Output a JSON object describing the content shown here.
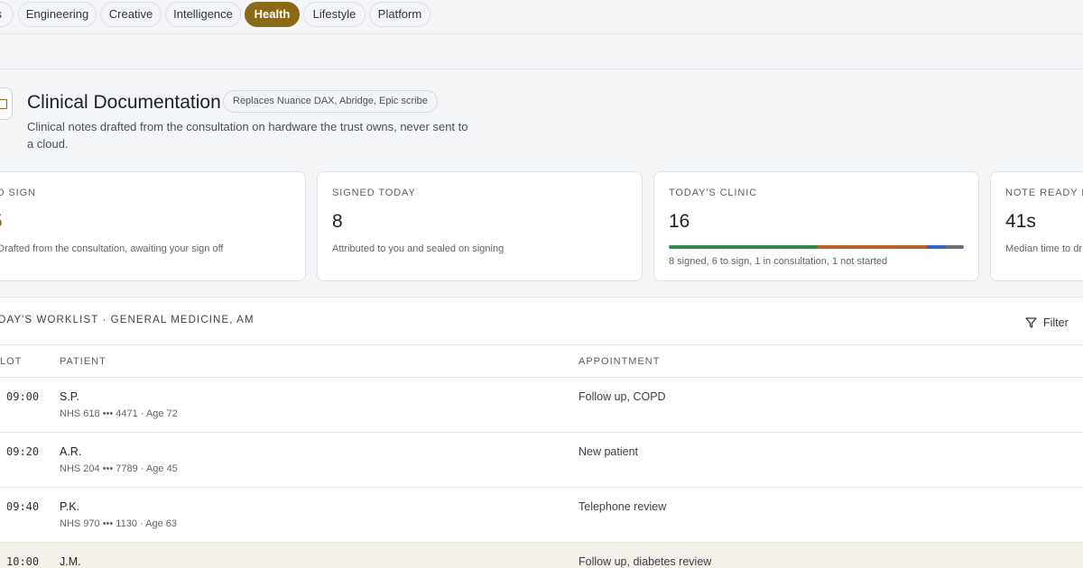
{
  "tabs": [
    {
      "label": "s",
      "active": false
    },
    {
      "label": "Engineering",
      "active": false
    },
    {
      "label": "Creative",
      "active": false
    },
    {
      "label": "Intelligence",
      "active": false
    },
    {
      "label": "Health",
      "active": true
    },
    {
      "label": "Lifestyle",
      "active": false
    },
    {
      "label": "Platform",
      "active": false
    }
  ],
  "header": {
    "title": "Clinical Documentation",
    "badge": "Replaces Nuance DAX, Abridge, Epic scribe",
    "subtitle": "Clinical notes drafted from the consultation on hardware the trust owns, never sent to a cloud.",
    "icon": "document-icon",
    "accent_color": "#8a6a16"
  },
  "stats": {
    "to_sign": {
      "label": "O SIGN",
      "value": "5",
      "desc": "Drafted from the consultation, awaiting your sign off"
    },
    "signed_today": {
      "label": "SIGNED TODAY",
      "value": "8",
      "desc": "Attributed to you and sealed on signing"
    },
    "todays_clinic": {
      "label": "TODAY'S CLINIC",
      "value": "16",
      "desc": "8 signed, 6 to sign, 1 in consultation, 1 not started",
      "segments": [
        {
          "name": "signed",
          "count": 8,
          "color": "#2f8a4a"
        },
        {
          "name": "to sign",
          "count": 6,
          "color": "#b8612a"
        },
        {
          "name": "in consultation",
          "count": 1,
          "color": "#3464c4"
        },
        {
          "name": "not started",
          "count": 1,
          "color": "#6b7079"
        }
      ]
    },
    "note_ready": {
      "label": "NOTE READY IN",
      "value": "41s",
      "desc": "Median time to dr"
    }
  },
  "worklist": {
    "title": "ODAY'S WORKLIST · GENERAL MEDICINE, AM",
    "filter_label": "Filter",
    "columns": {
      "slot": "LOT",
      "patient": "PATIENT",
      "appointment": "APPOINTMENT"
    },
    "rows": [
      {
        "slot": "09:00",
        "patient": "S.P.",
        "meta": "NHS 618 ••• 4471 · Age 72",
        "appointment": "Follow up, COPD"
      },
      {
        "slot": "09:20",
        "patient": "A.R.",
        "meta": "NHS 204 ••• 7789 · Age 45",
        "appointment": "New patient"
      },
      {
        "slot": "09:40",
        "patient": "P.K.",
        "meta": "NHS 970 ••• 1130 · Age 63",
        "appointment": "Telephone review"
      },
      {
        "slot": "10:00",
        "patient": "J.M.",
        "meta": "",
        "appointment": "Follow up, diabetes review"
      }
    ]
  }
}
